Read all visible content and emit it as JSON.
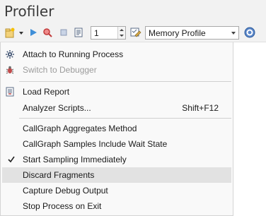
{
  "window": {
    "title": "Profiler"
  },
  "toolbar": {
    "sample_count": "1",
    "profile_select": {
      "selected": "Memory Profile"
    },
    "icons": [
      "new-profile-icon",
      "dropdown-arrow-icon",
      "run-icon",
      "search-icon",
      "stop-icon",
      "report-icon",
      "spin-stepper",
      "settings-icon",
      "help-icon"
    ]
  },
  "menu": {
    "items": [
      {
        "label": "Attach to Running Process",
        "icon": "gear-icon",
        "disabled": false
      },
      {
        "label": "Switch to Debugger",
        "icon": "bug-icon",
        "disabled": true
      },
      {
        "label": "Load Report",
        "icon": "report-icon",
        "disabled": false
      },
      {
        "label": "Analyzer Scripts...",
        "shortcut": "Shift+F12",
        "disabled": false
      },
      {
        "label": "CallGraph Aggregates Method",
        "disabled": false
      },
      {
        "label": "CallGraph Samples Include Wait State",
        "disabled": false
      },
      {
        "label": "Start Sampling Immediately",
        "checked": true,
        "disabled": false
      },
      {
        "label": "Discard Fragments",
        "highlighted": true,
        "disabled": false
      },
      {
        "label": "Capture Debug Output",
        "disabled": false
      },
      {
        "label": "Stop Process on Exit",
        "disabled": false
      }
    ]
  }
}
